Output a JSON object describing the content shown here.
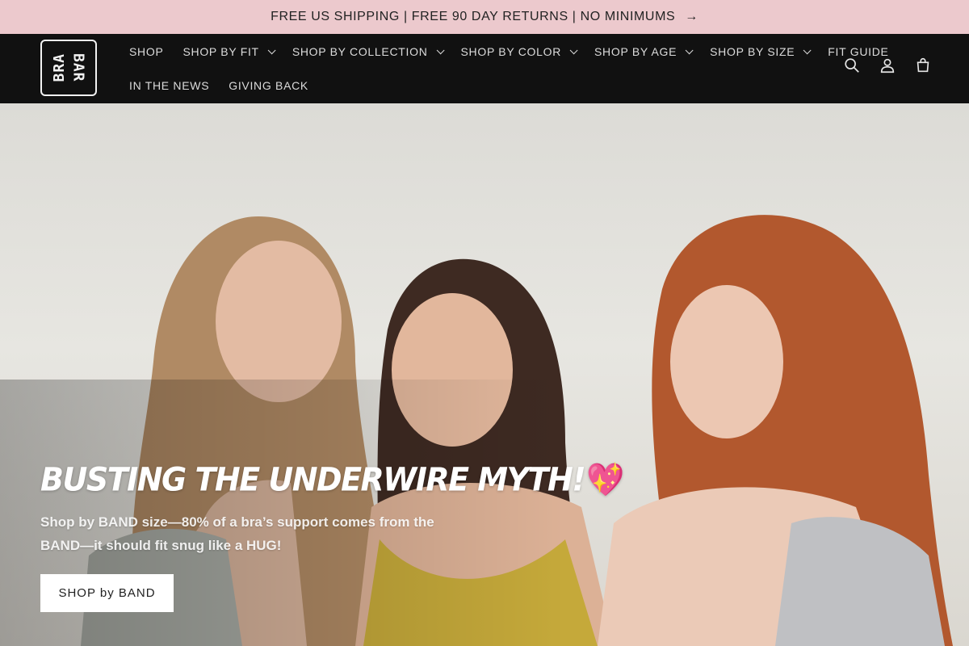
{
  "announcement": {
    "text": "FREE US SHIPPING | FREE 90 DAY RETURNS | NO MINIMUMS",
    "arrow": "→"
  },
  "logo": {
    "left_text": "BRA",
    "right_text": "BAR"
  },
  "nav": {
    "row1": [
      {
        "label": "SHOP",
        "dropdown": false
      },
      {
        "label": "SHOP BY FIT",
        "dropdown": true
      },
      {
        "label": "SHOP BY COLLECTION",
        "dropdown": true
      },
      {
        "label": "SHOP BY COLOR",
        "dropdown": true
      },
      {
        "label": "SHOP BY AGE",
        "dropdown": true
      },
      {
        "label": "SHOP BY SIZE",
        "dropdown": true
      },
      {
        "label": "FIT GUIDE",
        "dropdown": false
      }
    ],
    "row2": [
      {
        "label": "IN THE NEWS",
        "dropdown": false
      },
      {
        "label": "GIVING BACK",
        "dropdown": false
      }
    ]
  },
  "header_icons": [
    "search-icon",
    "account-icon",
    "cart-icon"
  ],
  "hero": {
    "title": "BUSTING THE UNDERWIRE MYTH!",
    "title_emoji": "💖",
    "subtitle": "Shop by BAND size—80% of a bra’s support comes from the BAND—it should fit snug like a HUG!",
    "button_label": "SHOP by BAND"
  },
  "colors": {
    "announcement_bg": "#ecc9cd",
    "header_bg": "#111111",
    "hero_bg": "#e3e2dd"
  }
}
